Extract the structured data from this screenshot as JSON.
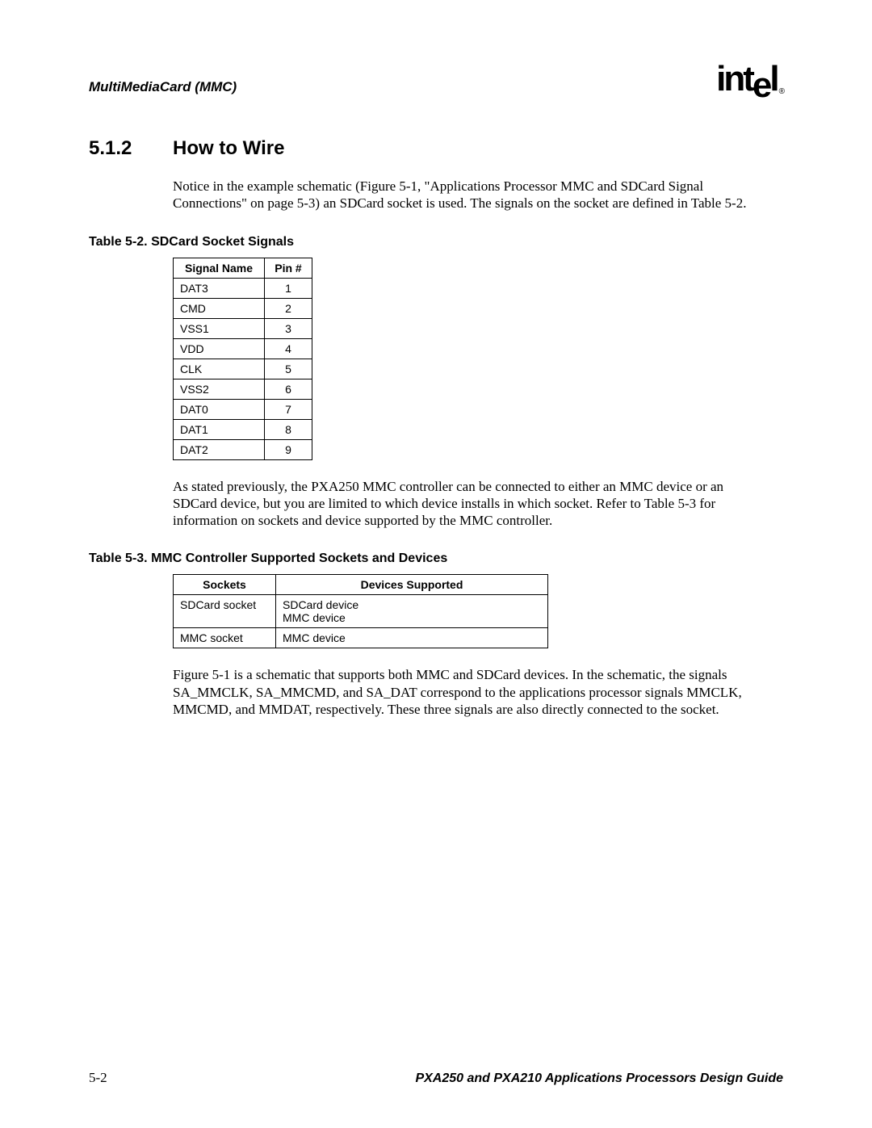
{
  "header": {
    "chapter": "MultiMediaCard (MMC)",
    "logo_text": "intel",
    "logo_reg": "®"
  },
  "section": {
    "number": "5.1.2",
    "title": "How to Wire",
    "para1": "Notice in the example schematic (Figure 5-1, \"Applications Processor MMC and SDCard Signal Connections\" on page 5-3) an SDCard socket is used. The signals on the socket are defined in Table 5-2.",
    "para2": "As stated previously, the PXA250 MMC controller can be connected to either an MMC device or an SDCard device, but you are limited to which device installs in which socket. Refer to Table 5-3 for information on sockets and device supported by the MMC controller.",
    "para3": "Figure 5-1 is a schematic that supports both MMC and SDCard devices. In the schematic, the signals SA_MMCLK, SA_MMCMD, and SA_DAT correspond to the applications processor signals MMCLK, MMCMD, and MMDAT, respectively. These three signals are also directly connected to the socket."
  },
  "table1": {
    "caption": "Table 5-2. SDCard Socket Signals",
    "headers": [
      "Signal Name",
      "Pin #"
    ],
    "rows": [
      [
        "DAT3",
        "1"
      ],
      [
        "CMD",
        "2"
      ],
      [
        "VSS1",
        "3"
      ],
      [
        "VDD",
        "4"
      ],
      [
        "CLK",
        "5"
      ],
      [
        "VSS2",
        "6"
      ],
      [
        "DAT0",
        "7"
      ],
      [
        "DAT1",
        "8"
      ],
      [
        "DAT2",
        "9"
      ]
    ]
  },
  "table2": {
    "caption": "Table 5-3. MMC Controller Supported Sockets and Devices",
    "headers": [
      "Sockets",
      "Devices Supported"
    ],
    "rows": [
      [
        "SDCard socket",
        "SDCard device\nMMC device"
      ],
      [
        "MMC socket",
        "MMC device"
      ]
    ]
  },
  "footer": {
    "page": "5-2",
    "doc_title": "PXA250 and PXA210 Applications Processors Design Guide"
  }
}
